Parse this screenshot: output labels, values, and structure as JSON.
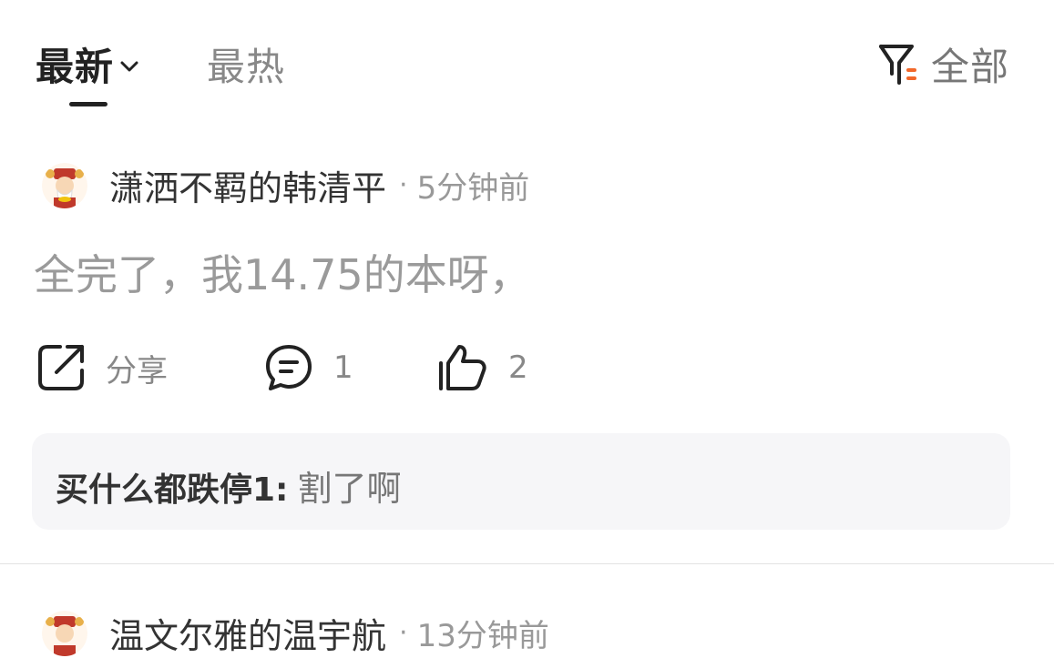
{
  "tabs": {
    "latest": "最新",
    "hot": "最热",
    "filter": "全部"
  },
  "comments": [
    {
      "username": "潇洒不羁的韩清平",
      "time": "5分钟前",
      "text": "全完了，我14.75的本呀，",
      "actions": {
        "share": "分享",
        "reply_count": "1",
        "like_count": "2"
      },
      "reply": {
        "user": "买什么都跌停1:",
        "text": "割了啊"
      }
    },
    {
      "username": "温文尔雅的温宇航",
      "time": "13分钟前"
    }
  ],
  "separator": "·",
  "colors": {
    "accent": "#f2682a",
    "text_primary": "#222222",
    "text_muted": "#999999",
    "reply_bg": "#f6f6f8"
  }
}
